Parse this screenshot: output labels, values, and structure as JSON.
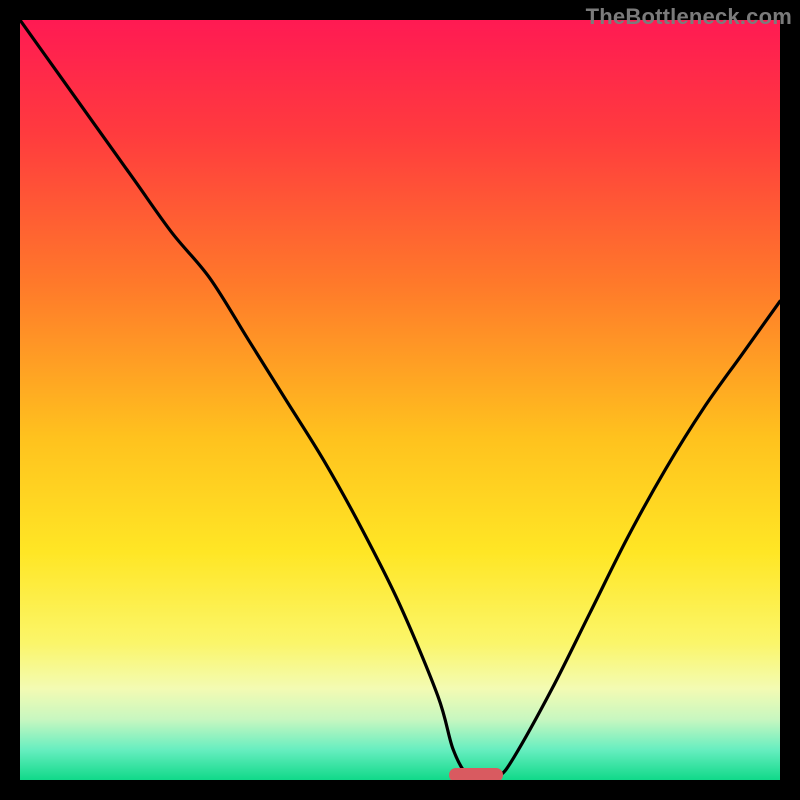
{
  "watermark": "TheBottleneck.com",
  "chart_data": {
    "type": "line",
    "title": "",
    "xlabel": "",
    "ylabel": "",
    "xlim": [
      0,
      100
    ],
    "ylim": [
      0,
      100
    ],
    "x": [
      0,
      5,
      10,
      15,
      20,
      25,
      30,
      35,
      40,
      45,
      50,
      55,
      57,
      59,
      61,
      63,
      65,
      70,
      75,
      80,
      85,
      90,
      95,
      100
    ],
    "values": [
      100,
      93,
      86,
      79,
      72,
      66,
      58,
      50,
      42,
      33,
      23,
      11,
      4,
      0.5,
      0.3,
      0.5,
      3,
      12,
      22,
      32,
      41,
      49,
      56,
      63
    ],
    "gradient_stops": [
      {
        "pos": 0,
        "color": "#ff1a53"
      },
      {
        "pos": 15,
        "color": "#ff3b3e"
      },
      {
        "pos": 35,
        "color": "#ff7a2a"
      },
      {
        "pos": 55,
        "color": "#ffc21e"
      },
      {
        "pos": 70,
        "color": "#ffe625"
      },
      {
        "pos": 82,
        "color": "#fbf66a"
      },
      {
        "pos": 88,
        "color": "#f3fbb3"
      },
      {
        "pos": 92,
        "color": "#c8f7c0"
      },
      {
        "pos": 96,
        "color": "#67eec0"
      },
      {
        "pos": 100,
        "color": "#10d989"
      }
    ],
    "marker": {
      "x_start": 56.5,
      "x_end": 63.5,
      "y": 0.7,
      "color": "#d95a60"
    }
  }
}
